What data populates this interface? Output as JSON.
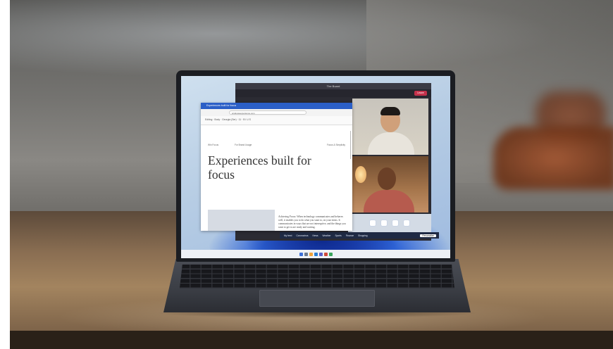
{
  "browser": {
    "title": "Experiences built for focus",
    "url": "windowsexperience.com",
    "toolbar": "Editing  ·  Body  ·  Georgia (Ser)  ·  11  ·  B  I  U  S",
    "nav_left": "Win Focus",
    "nav_mid": "For Brand Usage",
    "nav_right": "Focus & Simplicity",
    "heading": "Experiences built for focus",
    "body": "Achieving Focus: When technology communicates and behaves well, it enables you to do what you want to, on your terms. It communicates in ways that are not interruptive, and the things you want to get to are ready and waiting."
  },
  "teams": {
    "title": "The Board",
    "leave_label": "Leave"
  },
  "news_bar": {
    "items": [
      "My feed",
      "Coronavirus",
      "News",
      "Weather",
      "Sports",
      "Finance",
      "Shopping"
    ],
    "button": "Personalize"
  },
  "colors": {
    "teams_leave": "#c4314b",
    "browser_title": "#2b5fc7",
    "bloom": "#2e63d6"
  }
}
